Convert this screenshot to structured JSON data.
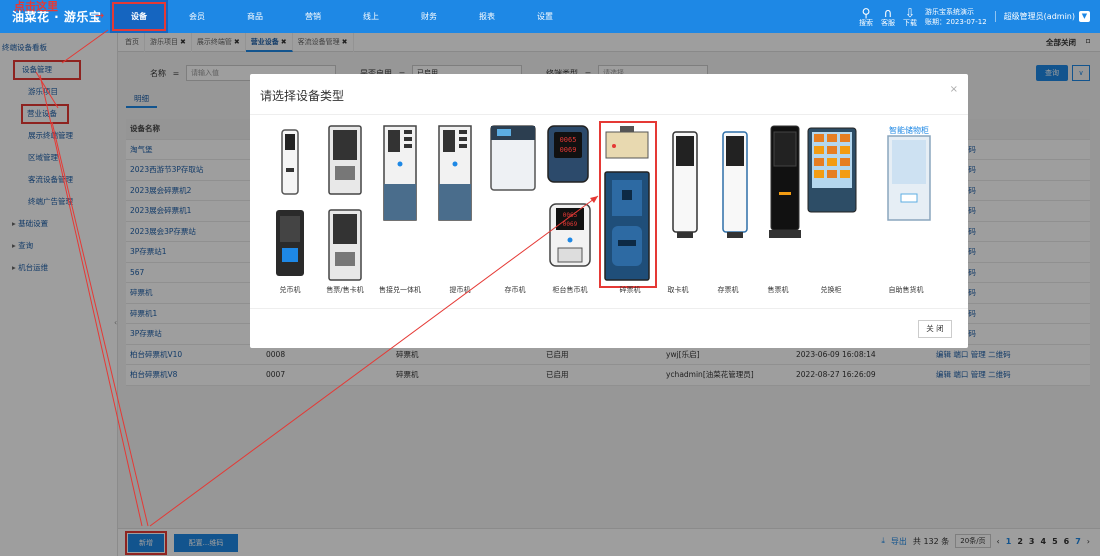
{
  "brand": {
    "name": "油菜花 · 游乐宝",
    "hint": "点击这里",
    "arrow": "→"
  },
  "nav": [
    "设备",
    "会员",
    "商品",
    "营销",
    "线上",
    "财务",
    "报表",
    "设置"
  ],
  "topbar_right": {
    "search": "搜索",
    "service": "客服",
    "download": "下载",
    "system": "游乐宝系统演示",
    "expire": "账期：2023-07-12",
    "admin": "超级管理员(admin)"
  },
  "sidebar": {
    "items": [
      "终端设备看板",
      "设备管理",
      "游乐项目",
      "营业设备",
      "展示终端管理",
      "区域管理",
      "客流设备管理",
      "终端广告管理",
      "基础设置",
      "查询",
      "机台运维"
    ]
  },
  "tabs": {
    "items": [
      "首页",
      "游乐项目",
      "展示终端管",
      "营业设备",
      "客流设备管理"
    ],
    "close_all": "全部关闭"
  },
  "filter": {
    "name_label": "名称",
    "op": "=",
    "name_placeholder": "请输入值",
    "enabled_label": "是否启用",
    "enabled_value": "已启用",
    "type_label": "终端类型",
    "type_placeholder": "请选择",
    "query": "查询"
  },
  "subtab": "明细",
  "table": {
    "headers": [
      "设备名称",
      "",
      "",
      "",
      "",
      "",
      ""
    ],
    "rows": [
      [
        "淘气堡",
        "",
        "",
        "",
        "",
        "",
        "管理 二维码"
      ],
      [
        "2023西游节3P存取站",
        "",
        "",
        "",
        "",
        "",
        "管理 二维码"
      ],
      [
        "2023展会碎票机2",
        "",
        "",
        "",
        "",
        "",
        "管理 二维码"
      ],
      [
        "2023展会碎票机1",
        "",
        "",
        "",
        "",
        "",
        "管理 二维码"
      ],
      [
        "2023展会3P存票站",
        "",
        "",
        "",
        "",
        "",
        "管理 二维码"
      ],
      [
        "3P存票站1",
        "",
        "",
        "",
        "",
        "",
        "管理 二维码"
      ],
      [
        "567",
        "",
        "",
        "",
        "",
        "",
        "管理 二维码"
      ],
      [
        "碎票机",
        "",
        "",
        "",
        "",
        "",
        "管理 二维码"
      ],
      [
        "碎票机1",
        "",
        "",
        "",
        "",
        "",
        "管理 二维码"
      ],
      [
        "3P存票站",
        "",
        "",
        "",
        "",
        "",
        "管理 二维码"
      ],
      [
        "柏台碎票机V10",
        "0008",
        "碎票机",
        "已启用",
        "ywj[乐启]",
        "2023-06-09 16:08:14",
        "编辑 端口 管理 二维码"
      ],
      [
        "柏台碎票机V8",
        "0007",
        "碎票机",
        "已启用",
        "ychadmin[油菜花管理员]",
        "2022-08-27 16:26:09",
        "编辑 端口 管理 二维码"
      ]
    ]
  },
  "bottom": {
    "new": "新增",
    "bind": "配置...维码",
    "export": "导出",
    "total": "共 132 条",
    "size": "20条/页",
    "pages": [
      "1",
      "2",
      "3",
      "4",
      "5",
      "6",
      "7"
    ]
  },
  "modal": {
    "title": "请选择设备类型",
    "close": "×",
    "close_btn": "关 闭",
    "devices": [
      "兑币机",
      "售票/售卡机",
      "售接兑一体机",
      "提币机",
      "存币机",
      "柜台售币机",
      "碎票机",
      "取卡机",
      "存票机",
      "售票机",
      "兑换柜",
      "自助售货机"
    ],
    "screen_text": [
      "0065",
      "0069",
      "0065",
      "0069"
    ],
    "locker_banner": "智能储物柜"
  },
  "colors": {
    "primary": "#1e88e5",
    "annotation": "#e53935"
  }
}
